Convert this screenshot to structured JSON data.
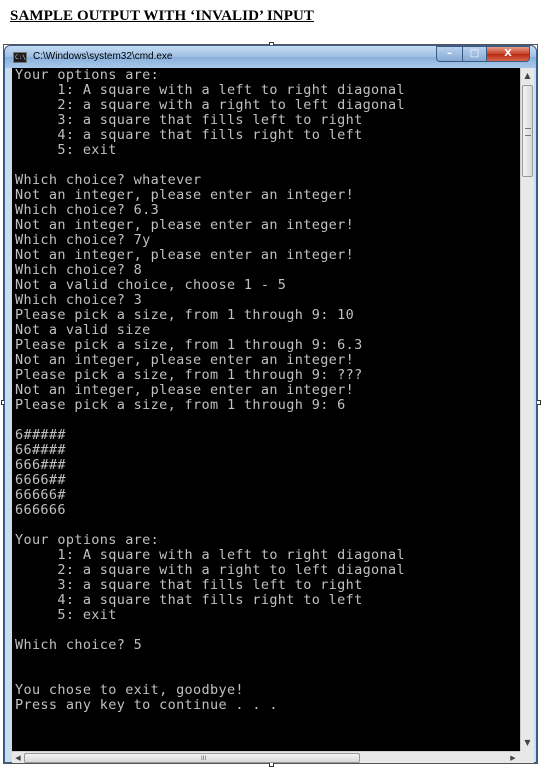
{
  "heading": "SAMPLE OUTPUT WITH ‘INVALID’ INPUT",
  "window": {
    "title": "C:\\Windows\\system32\\cmd.exe",
    "buttons": {
      "minimize": "–",
      "maximize": "□",
      "close": "X"
    }
  },
  "console_lines": [
    "Your options are:",
    "     1: A square with a left to right diagonal",
    "     2: a square with a right to left diagonal",
    "     3: a square that fills left to right",
    "     4: a square that fills right to left",
    "     5: exit",
    "",
    "Which choice? whatever",
    "Not an integer, please enter an integer!",
    "Which choice? 6.3",
    "Not an integer, please enter an integer!",
    "Which choice? 7y",
    "Not an integer, please enter an integer!",
    "Which choice? 8",
    "Not a valid choice, choose 1 - 5",
    "Which choice? 3",
    "Please pick a size, from 1 through 9: 10",
    "Not a valid size",
    "Please pick a size, from 1 through 9: 6.3",
    "Not an integer, please enter an integer!",
    "Please pick a size, from 1 through 9: ???",
    "Not an integer, please enter an integer!",
    "Please pick a size, from 1 through 9: 6",
    "",
    "6#####",
    "66####",
    "666###",
    "6666##",
    "66666#",
    "666666",
    "",
    "Your options are:",
    "     1: A square with a left to right diagonal",
    "     2: a square with a right to left diagonal",
    "     3: a square that fills left to right",
    "     4: a square that fills right to left",
    "     5: exit",
    "",
    "Which choice? 5",
    "",
    "",
    "You chose to exit, goodbye!",
    "Press any key to continue . . ."
  ],
  "scrollbar": {
    "up_arrow": "▲",
    "down_arrow": "▼",
    "left_arrow": "◀",
    "right_arrow": "▶",
    "grip": "III"
  },
  "colors": {
    "console_background": "#000000",
    "console_text": "#c0c0c0",
    "close_button": "#c8432b"
  }
}
